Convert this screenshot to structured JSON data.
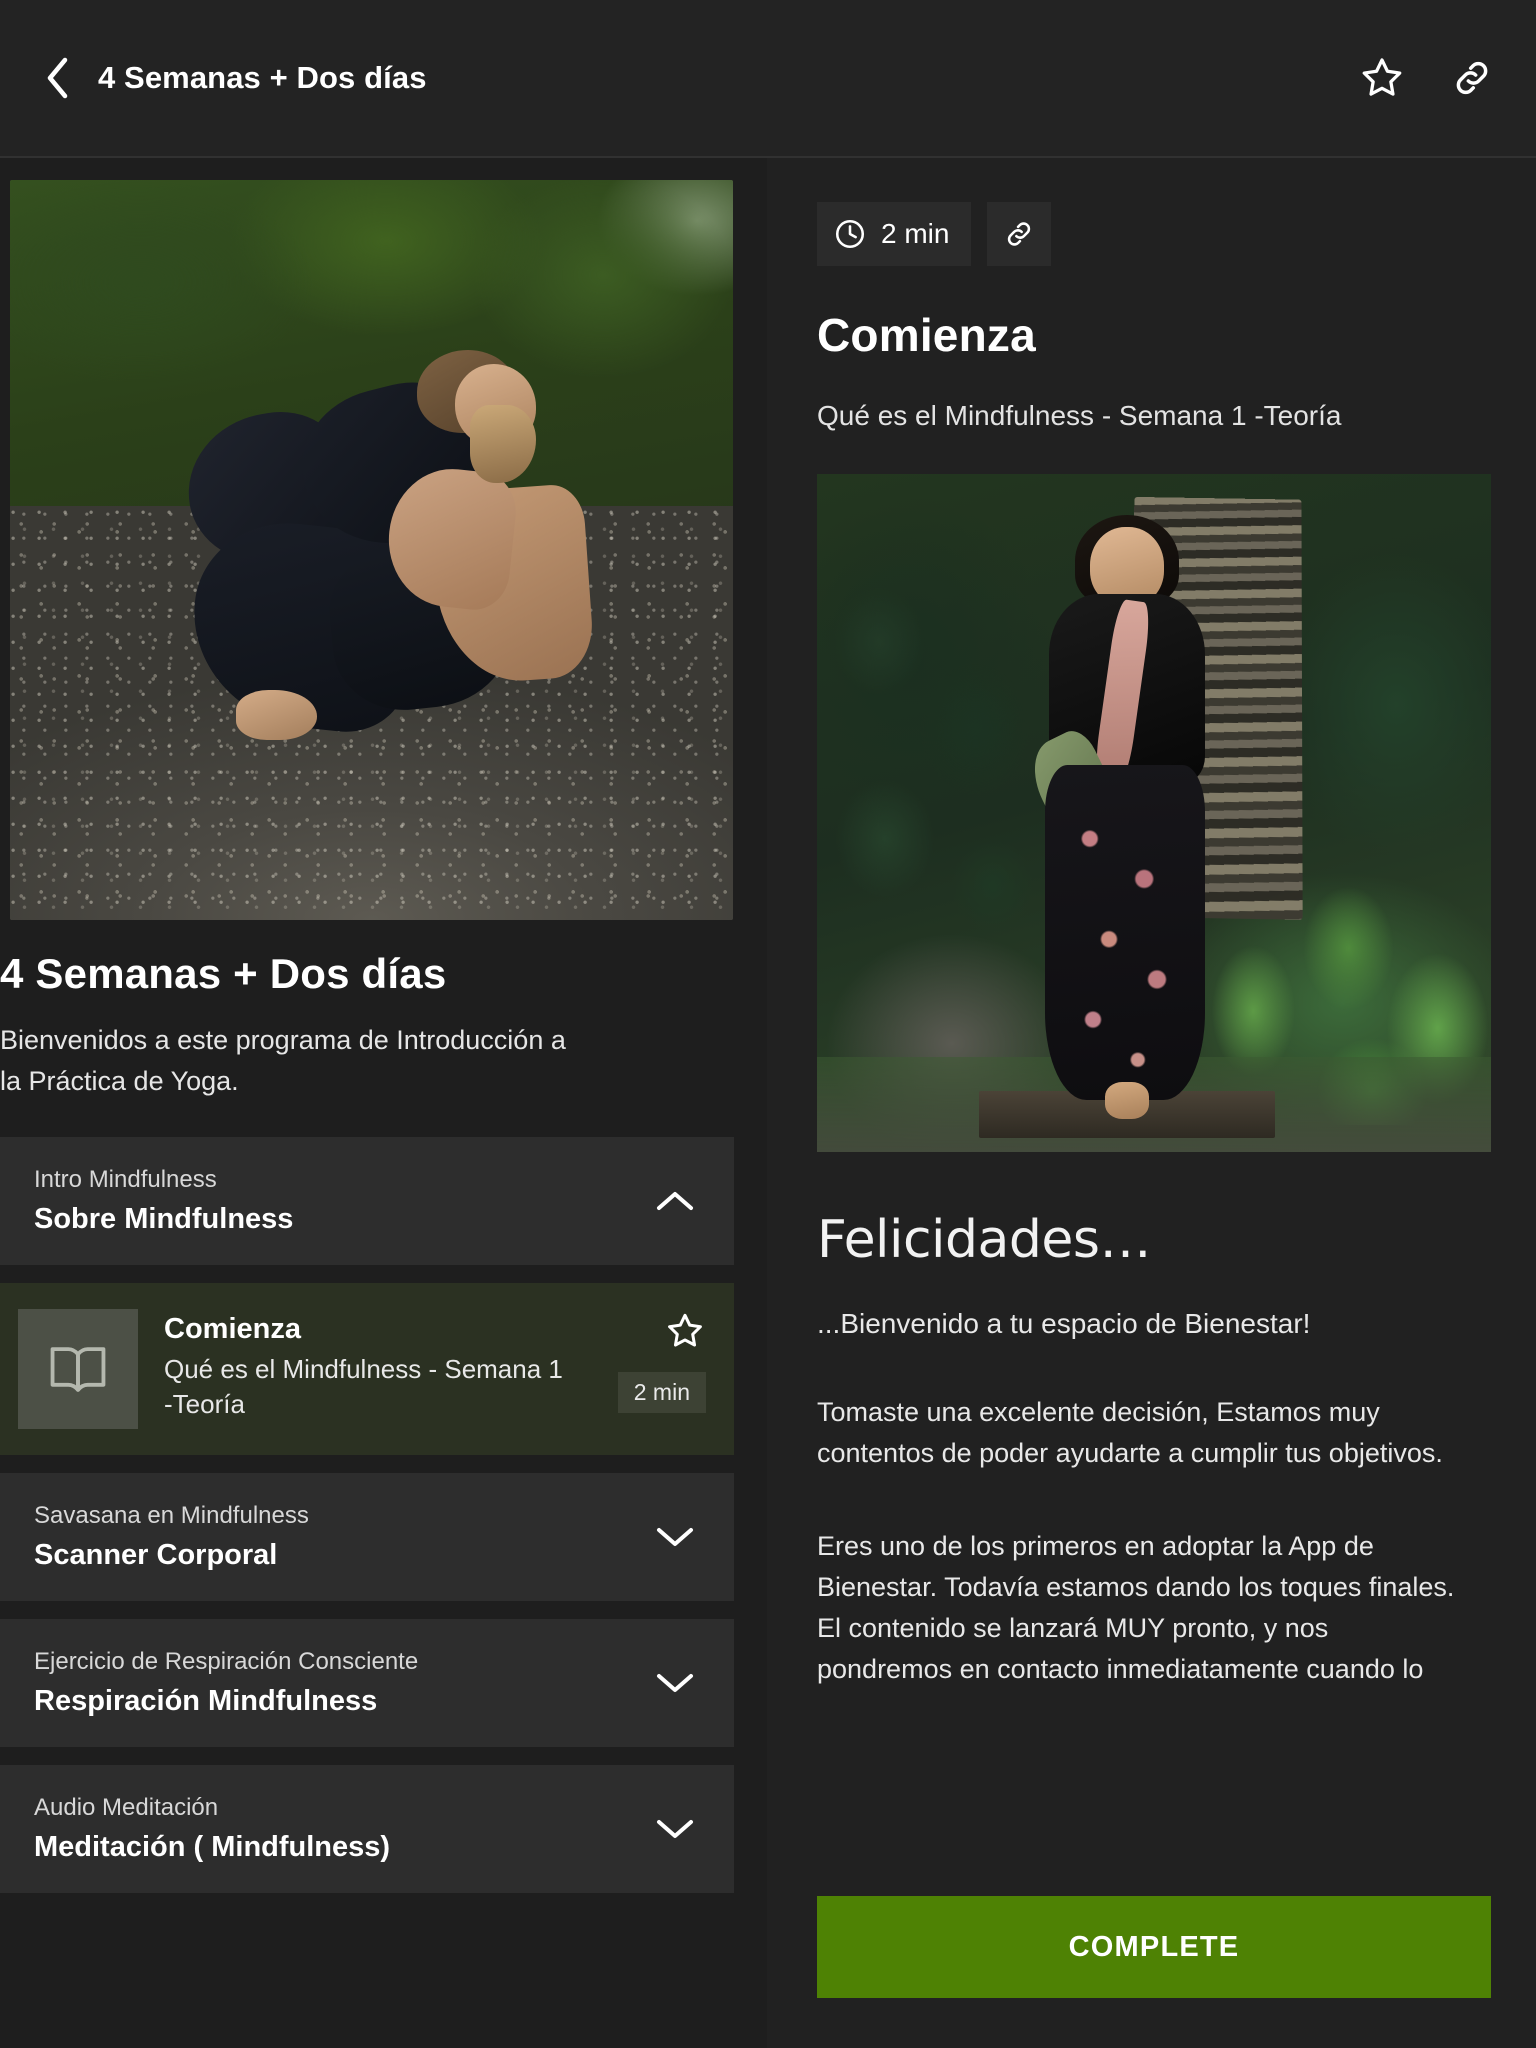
{
  "topbar": {
    "back_icon": "chevron-left-icon",
    "title": "4 Semanas + Dos días",
    "favorite_icon": "star-outline-icon",
    "link_icon": "link-icon"
  },
  "left_panel": {
    "hero_image_alt": "woman-stretching-on-road",
    "course_title": "4 Semanas + Dos días",
    "course_description": "Bienvenidos a este programa de Introducción a la Práctica de Yoga.",
    "sections": [
      {
        "subtitle": "Intro Mindfulness",
        "title": "Sobre Mindfulness",
        "chevron": "chevron-up-icon",
        "expanded": true
      },
      {
        "subtitle": "Savasana en Mindfulness",
        "title": "Scanner Corporal",
        "chevron": "chevron-down-icon",
        "expanded": false
      },
      {
        "subtitle": "Ejercicio de Respiración Consciente",
        "title": "Respiración Mindfulness",
        "chevron": "chevron-down-icon",
        "expanded": false
      },
      {
        "subtitle": "Audio Meditación",
        "title": "Meditación ( Mindfulness)",
        "chevron": "chevron-down-icon",
        "expanded": false
      }
    ],
    "active_lesson": {
      "thumb_icon": "book-icon",
      "title": "Comienza",
      "subtitle": "Qué es el Mindfulness - Semana 1 -Teoría",
      "star_icon": "star-outline-icon",
      "duration": "2 min"
    }
  },
  "right_panel": {
    "clock_icon": "clock-icon",
    "duration": "2 min",
    "link_icon": "link-icon",
    "lesson_title": "Comienza",
    "lesson_subtitle": "Qué es el Mindfulness - Semana 1 -Teoría",
    "content_image_alt": "woman-with-yoga-mat-in-garden",
    "content_heading": "Felicidades…",
    "content_lead": "...Bienvenido a tu espacio de Bienestar!",
    "paragraphs": [
      "Tomaste una excelente decisión, Estamos muy contentos de poder ayudarte a cumplir tus objetivos.",
      "Eres uno de los primeros en adoptar la App de Bienestar. Todavía estamos dando los toques finales. El contenido se lanzará MUY pronto, y nos pondremos en contacto inmediatamente cuando lo"
    ],
    "complete_button": "COMPLETE"
  },
  "colors": {
    "page_bg": "#1e1e1e",
    "topbar_bg": "#232323",
    "card_bg": "#2d2d2d",
    "active_lesson_bg": "#2b3122",
    "accent_green": "#4e8204",
    "text_primary": "#ffffff",
    "text_secondary": "#e0e0e0"
  }
}
